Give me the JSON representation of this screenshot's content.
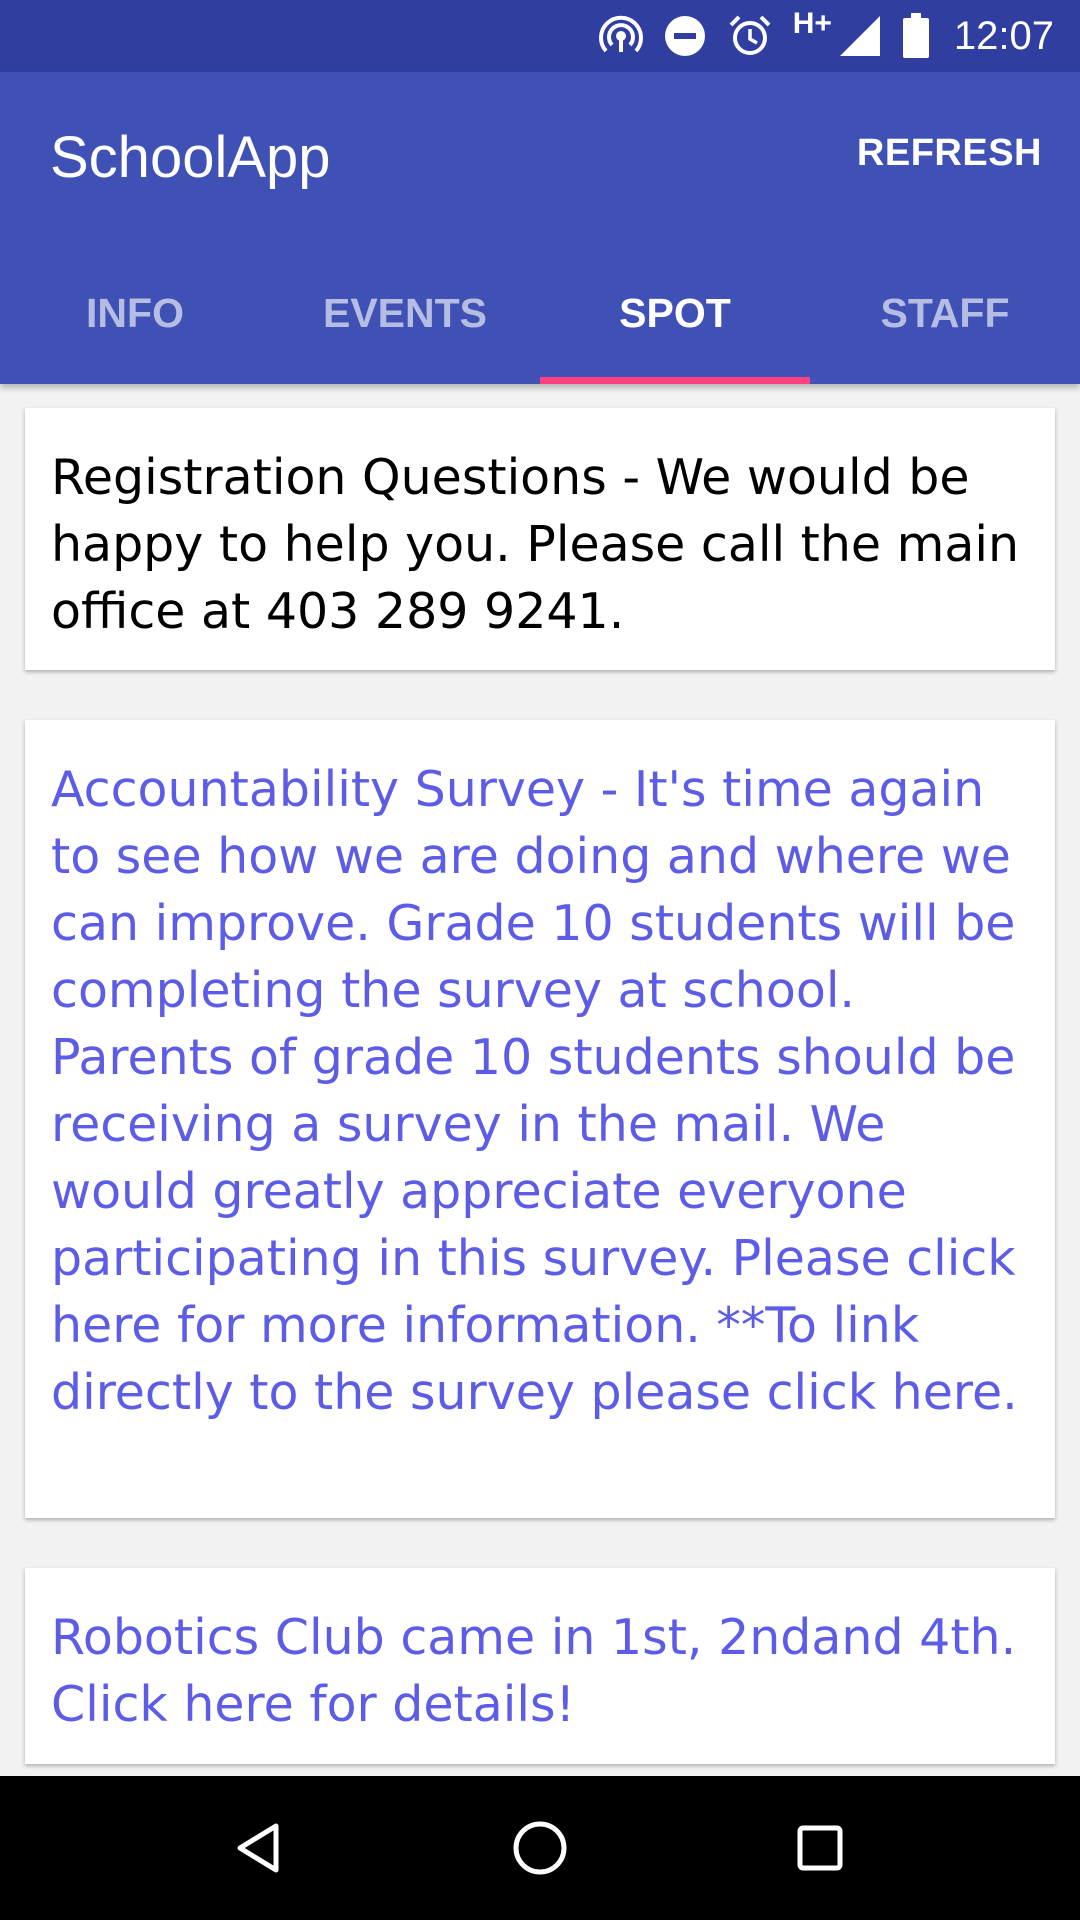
{
  "status_bar": {
    "network_type": "H+",
    "time": "12:07",
    "icons": [
      "hotspot-icon",
      "do-not-disturb-icon",
      "alarm-icon",
      "signal-icon",
      "battery-icon"
    ]
  },
  "app_bar": {
    "title": "SchoolApp",
    "refresh_label": "REFRESH",
    "background": "#3f51b5",
    "status_background": "#303f9f",
    "accent": "#ff4081"
  },
  "tabs": [
    {
      "label": "INFO",
      "active": false
    },
    {
      "label": "EVENTS",
      "active": false
    },
    {
      "label": "SPOT",
      "active": true
    },
    {
      "label": "STAFF",
      "active": false
    }
  ],
  "cards": [
    {
      "text": "Registration Questions -  We would be happy to help you. Please call the main office at 403 289 9241.",
      "is_link": false
    },
    {
      "text": "Accountability Survey - It's time again to see how we are doing and where we can improve. Grade 10 students will be completing the survey at school. Parents of grade 10 students should be receiving a survey in the mail. We would greatly appreciate everyone participating in this survey. Please click here for more information. **To link directly to the survey please click here.",
      "is_link": true
    },
    {
      "text": "Robotics Club came in 1st, 2ndand 4th. Click here for details!",
      "is_link": true
    }
  ],
  "link_color": "#5c5ce6",
  "nav_bar": {
    "buttons": [
      "back-icon",
      "home-icon",
      "recents-icon"
    ]
  }
}
